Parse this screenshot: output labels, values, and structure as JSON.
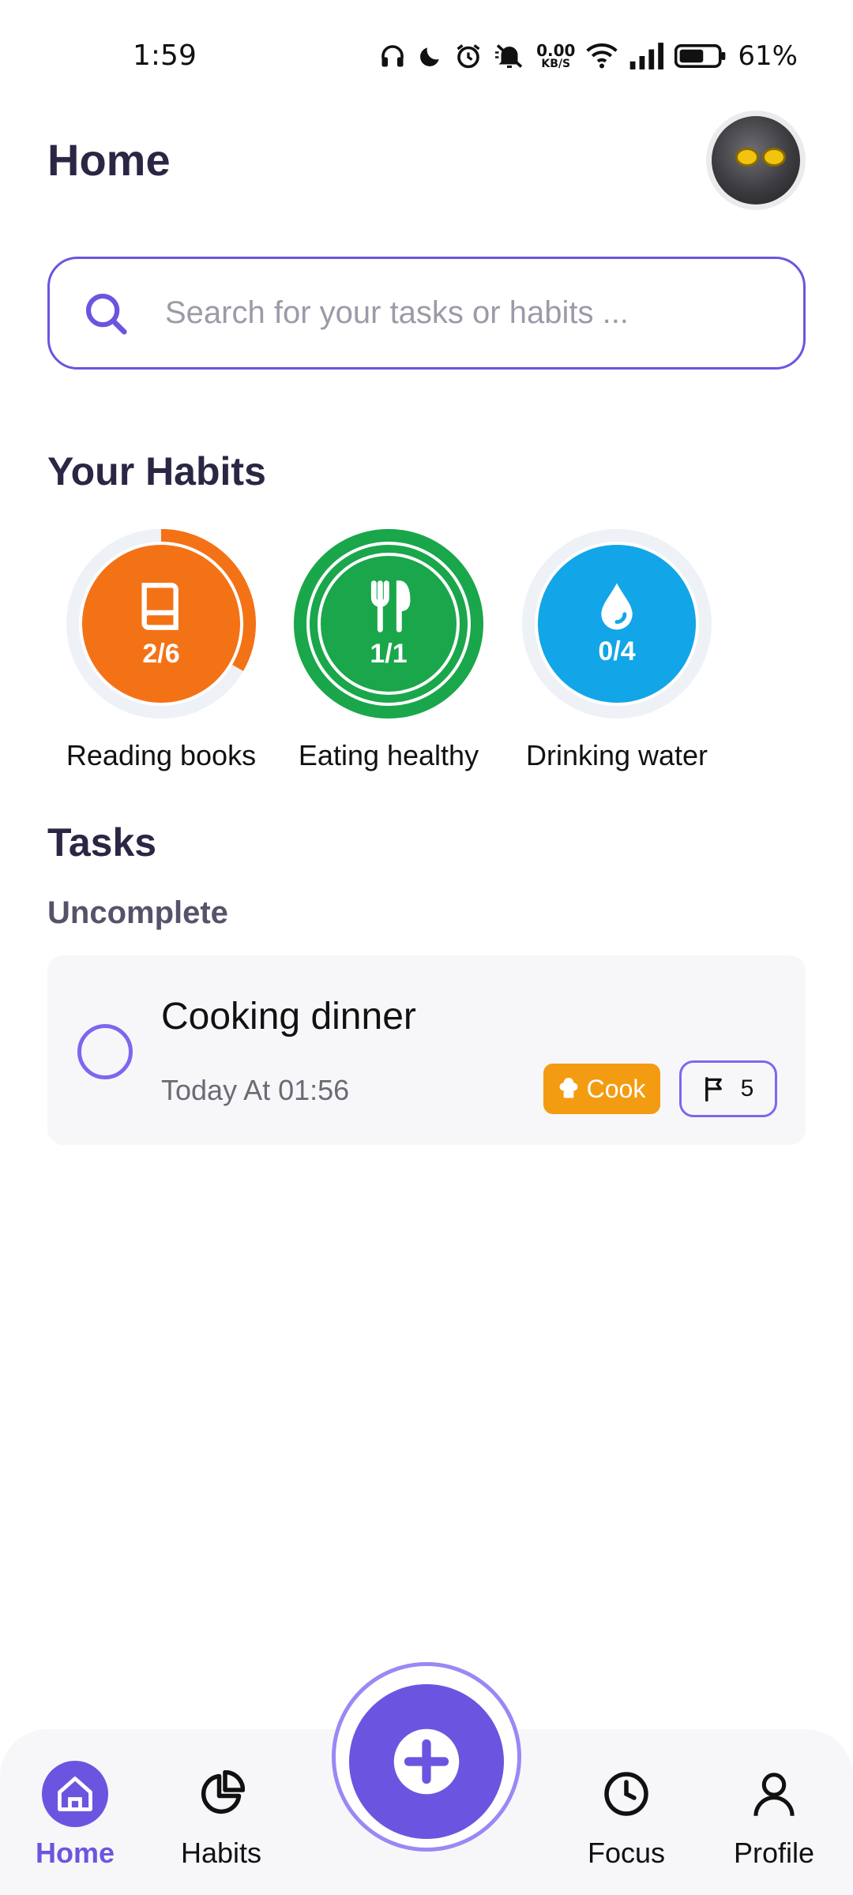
{
  "status_bar": {
    "time": "1:59",
    "net_speed_value": "0.00",
    "net_speed_unit": "KB/S",
    "battery_percent": "61%",
    "icons": [
      "headphones-icon",
      "moon-icon",
      "alarm-icon",
      "mute-icon",
      "wifi-icon",
      "signal-icon",
      "battery-icon"
    ]
  },
  "header": {
    "title": "Home"
  },
  "search": {
    "placeholder": "Search for your tasks or habits ..."
  },
  "habits_section": {
    "title": "Your Habits",
    "items": [
      {
        "label": "Reading books",
        "count": "2/6",
        "progress": 0.333,
        "color": "#f47216",
        "icon": "book-icon"
      },
      {
        "label": "Eating healthy",
        "count": "1/1",
        "progress": 1.0,
        "color": "#1aa64a",
        "icon": "fork-knife-icon"
      },
      {
        "label": "Drinking water",
        "count": "0/4",
        "progress": 0.0,
        "color": "#12a5e8",
        "icon": "water-drop-icon"
      }
    ]
  },
  "tasks_section": {
    "title": "Tasks",
    "group_label": "Uncomplete",
    "tasks": [
      {
        "title": "Cooking dinner",
        "time": "Today At 01:56",
        "category": "Cook",
        "priority": "5"
      }
    ]
  },
  "bottom_nav": {
    "items": [
      {
        "label": "Home",
        "icon": "home-icon",
        "active": true
      },
      {
        "label": "Habits",
        "icon": "pie-chart-icon",
        "active": false
      },
      {
        "label": "Focus",
        "icon": "clock-icon",
        "active": false
      },
      {
        "label": "Profile",
        "icon": "user-icon",
        "active": false
      }
    ],
    "fab_icon": "plus-icon"
  },
  "colors": {
    "accent": "#6b55e0",
    "text_dark": "#2a2745",
    "card_bg": "#f7f7fa",
    "cook_tag": "#f39c12"
  }
}
